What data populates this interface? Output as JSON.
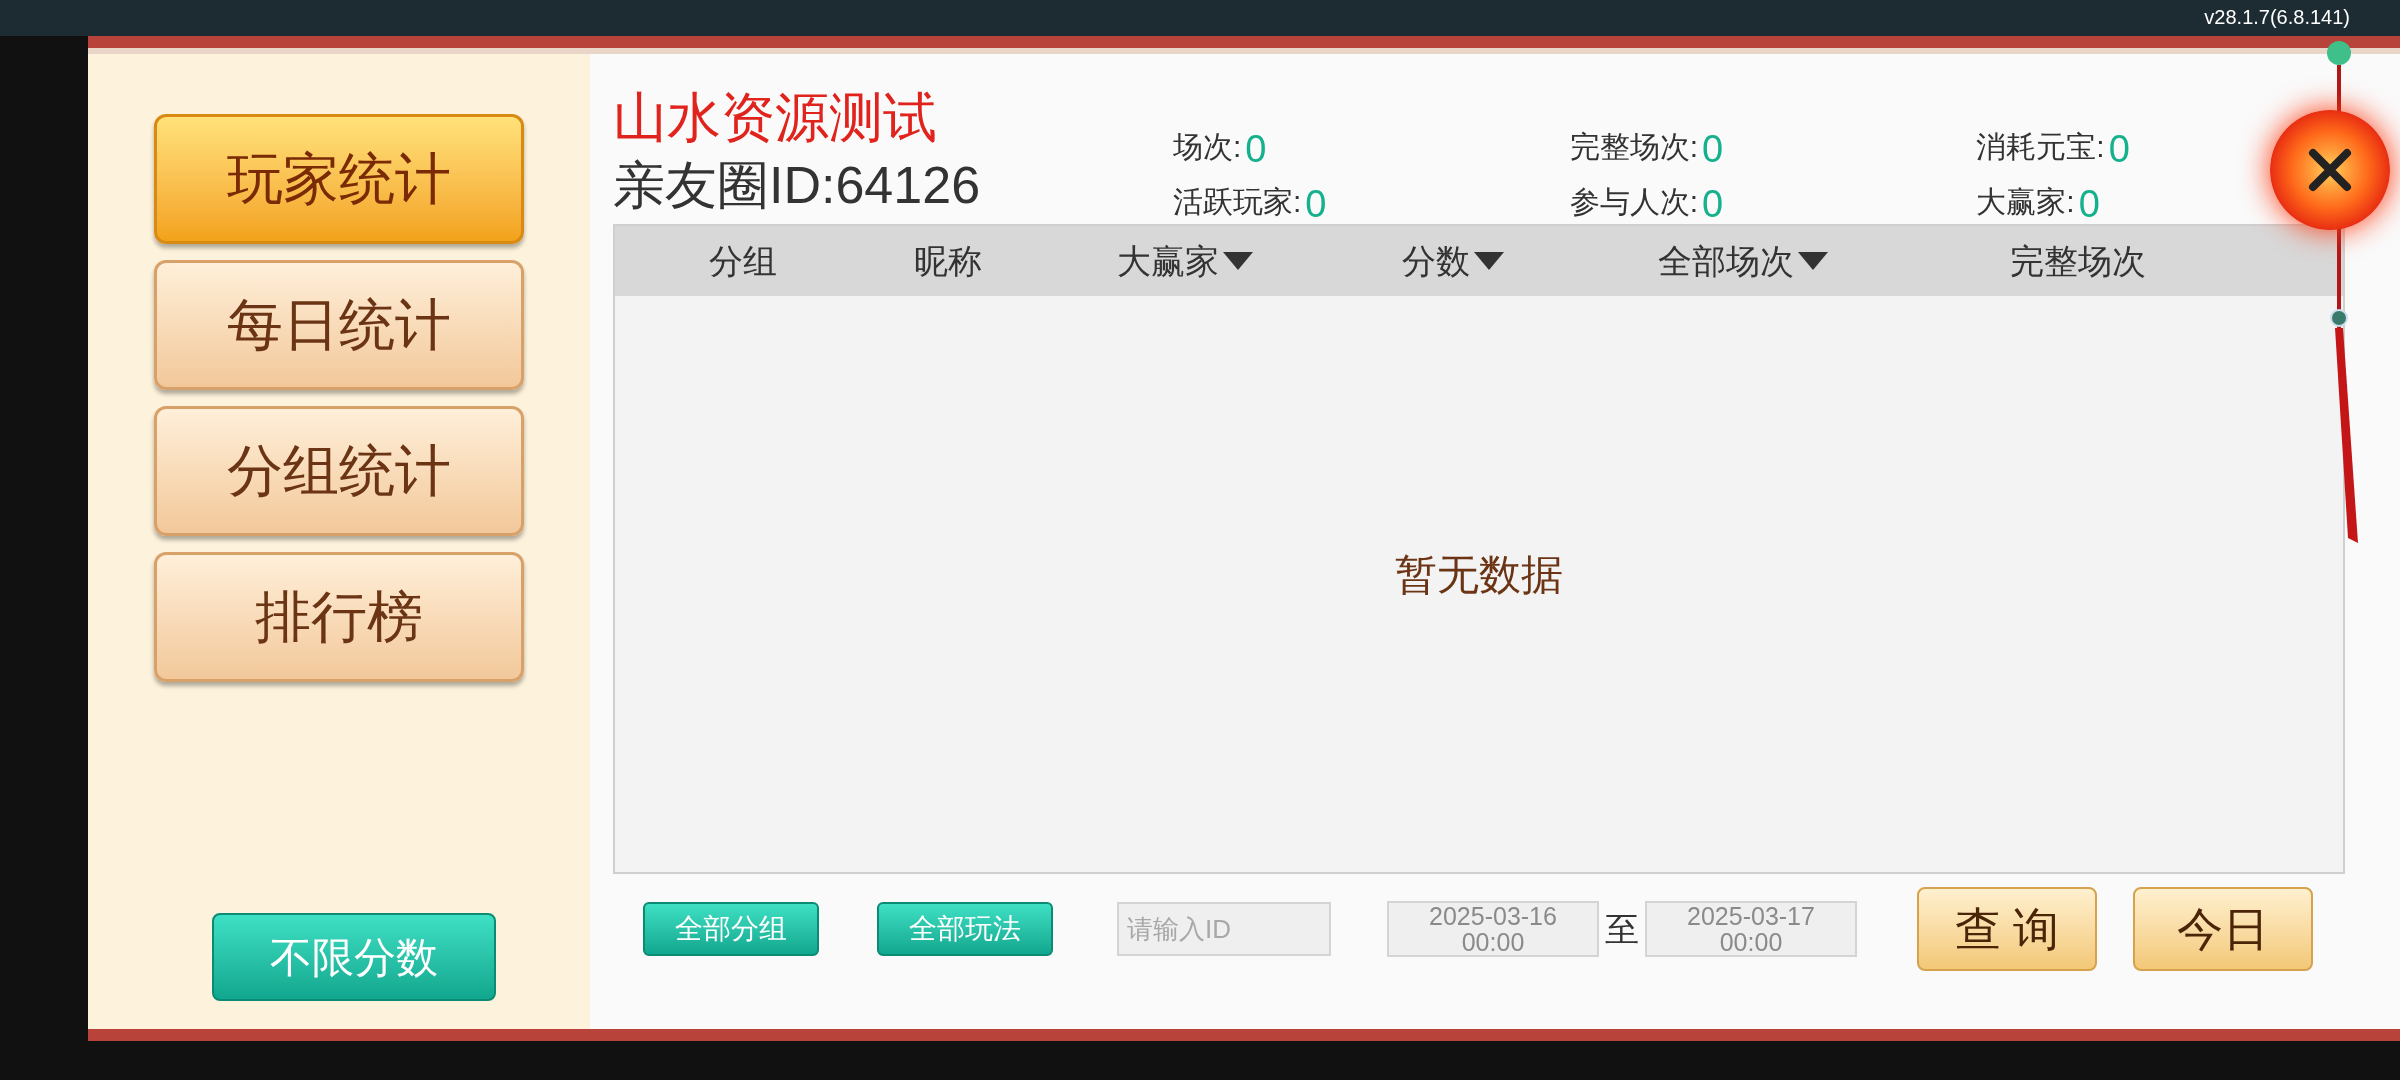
{
  "version": "v28.1.7(6.8.141)",
  "sidebar": {
    "items": [
      {
        "label": "玩家统计",
        "selected": true
      },
      {
        "label": "每日统计",
        "selected": false
      },
      {
        "label": "分组统计",
        "selected": false
      },
      {
        "label": "排行榜",
        "selected": false
      }
    ],
    "filter_button": "不限分数"
  },
  "header": {
    "title": "山水资源测试",
    "circle_id": "亲友圈ID:64126",
    "stats": [
      {
        "label": "场次:",
        "value": "0"
      },
      {
        "label": "完整场次:",
        "value": "0"
      },
      {
        "label": "消耗元宝:",
        "value": "0"
      },
      {
        "label": "活跃玩家:",
        "value": "0"
      },
      {
        "label": "参与人次:",
        "value": "0"
      },
      {
        "label": "大赢家:",
        "value": "0"
      }
    ]
  },
  "table": {
    "columns": [
      {
        "label": "分组",
        "sortable": false
      },
      {
        "label": "昵称",
        "sortable": false
      },
      {
        "label": "大赢家",
        "sortable": true
      },
      {
        "label": "分数",
        "sortable": true
      },
      {
        "label": "全部场次",
        "sortable": true
      },
      {
        "label": "完整场次",
        "sortable": false
      }
    ],
    "empty_text": "暂无数据"
  },
  "footer": {
    "group_button": "全部分组",
    "mode_button": "全部玩法",
    "id_field": {
      "placeholder": "请输入ID"
    },
    "start": {
      "date": "2025-03-16",
      "time": "00:00"
    },
    "separator": "至",
    "end": {
      "date": "2025-03-17",
      "time": "00:00"
    },
    "query_button": "查 询",
    "today_button": "今日"
  }
}
